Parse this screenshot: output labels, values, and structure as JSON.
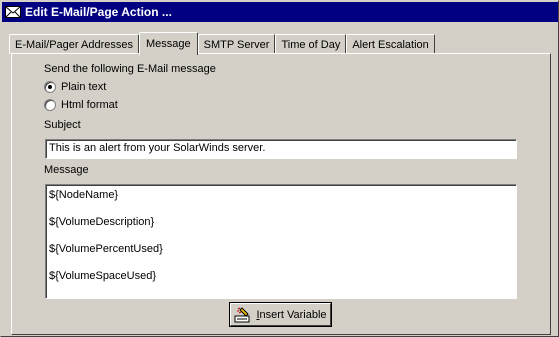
{
  "window": {
    "title": "Edit E-Mail/Page Action ...",
    "icon": "envelope-icon"
  },
  "tabs": [
    {
      "label": "E-Mail/Pager Addresses",
      "active": false
    },
    {
      "label": "Message",
      "active": true
    },
    {
      "label": "SMTP Server",
      "active": false
    },
    {
      "label": "Time of Day",
      "active": false
    },
    {
      "label": "Alert Escalation",
      "active": false
    }
  ],
  "message": {
    "format_label": "Send the following E-Mail message",
    "format_options": [
      {
        "label": "Plain text",
        "selected": true
      },
      {
        "label": "Html format",
        "selected": false
      }
    ],
    "subject_label": "Subject",
    "subject_value": "This is an alert from your SolarWinds server.",
    "message_label": "Message",
    "message_lines": [
      "${NodeName}",
      "${VolumeDescription}",
      "${VolumePercentUsed}",
      "${VolumeSpaceUsed}"
    ],
    "insert_button_label": "Insert Variable",
    "insert_button_icon": "insert-variable-icon"
  },
  "colors": {
    "titlebar": "#000080",
    "face": "#d4d0c8"
  }
}
